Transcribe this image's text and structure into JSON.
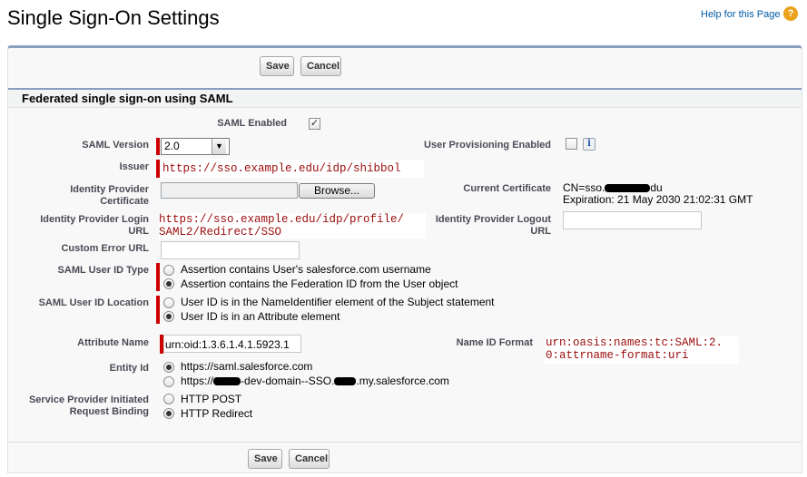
{
  "header": {
    "title": "Single Sign-On Settings",
    "help_label": "Help for this Page",
    "help_icon": "help-icon"
  },
  "buttons": {
    "save_label": "Save",
    "cancel_label": "Cancel"
  },
  "section": {
    "title": "Federated single sign-on using SAML"
  },
  "fields": {
    "saml_enabled": {
      "label": "SAML Enabled",
      "checked": true,
      "mark": "✓"
    },
    "saml_version": {
      "label": "SAML Version",
      "value": "2.0"
    },
    "user_provisioning": {
      "label": "User Provisioning Enabled",
      "checked": false,
      "info": "i"
    },
    "issuer": {
      "label": "Issuer",
      "value": "https://sso.example.edu/idp/shibbol"
    },
    "idp_certificate": {
      "label_line1": "Identity Provider",
      "label_line2": "Certificate",
      "browse_label": "Browse..."
    },
    "current_certificate": {
      "label": "Current Certificate",
      "cn_prefix": "CN=sso.",
      "cn_suffix": "du",
      "expiration": "Expiration: 21 May 2030 21:02:31 GMT"
    },
    "idp_login_url": {
      "label_line1": "Identity Provider Login",
      "label_line2": "URL",
      "value_line1": "https://sso.example.edu/idp/profile/",
      "value_line2": "SAML2/Redirect/SSO"
    },
    "idp_logout_url": {
      "label_line1": "Identity Provider Logout",
      "label_line2": "URL",
      "value": ""
    },
    "custom_error_url": {
      "label": "Custom Error URL",
      "value": ""
    },
    "saml_user_id_type": {
      "label": "SAML User ID Type",
      "options": [
        "Assertion contains User's salesforce.com username",
        "Assertion contains the Federation ID from the User object"
      ],
      "selected": 1
    },
    "saml_user_id_location": {
      "label": "SAML User ID Location",
      "options": [
        "User ID is in the NameIdentifier element of the Subject statement",
        "User ID is in an Attribute element"
      ],
      "selected": 1
    },
    "attribute_name": {
      "label": "Attribute Name",
      "value": "urn:oid:1.3.6.1.4.1.5923.1"
    },
    "name_id_format": {
      "label": "Name ID Format",
      "value_line1": "urn:oasis:names:tc:SAML:2.",
      "value_line2": "0:attrname-format:uri"
    },
    "entity_id": {
      "label": "Entity Id",
      "option1": "https://saml.salesforce.com",
      "option2_prefix": "https://",
      "option2_middle": "-dev-domain--SSO.",
      "option2_suffix": ".my.salesforce.com",
      "selected": 0
    },
    "sp_request_binding": {
      "label_line1": "Service Provider Initiated",
      "label_line2": "Request Binding",
      "options": [
        "HTTP POST",
        "HTTP Redirect"
      ],
      "selected": 1
    }
  },
  "colors": {
    "link": "#015ba7",
    "required": "#cc0000",
    "panel_border": "#8a9ebe",
    "mono_value": "#9a0b0b"
  }
}
